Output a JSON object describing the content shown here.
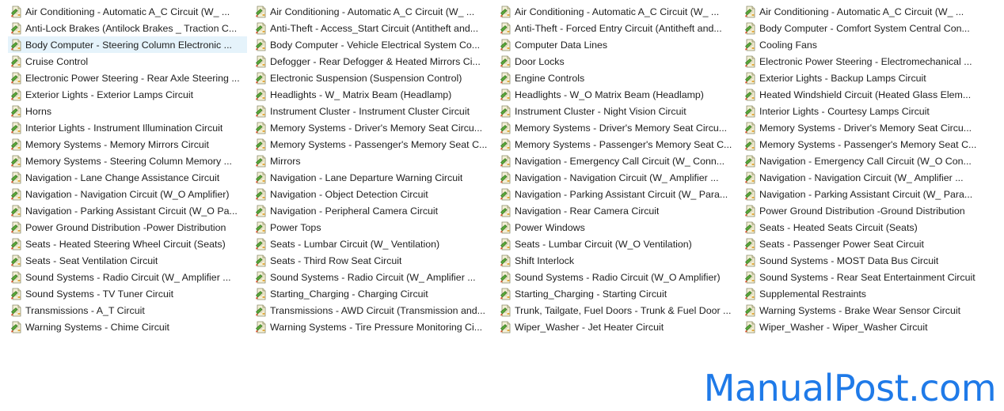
{
  "columns": [
    [
      "Air Conditioning - Automatic A_C Circuit (W_ ...",
      "Anti-Lock Brakes (Antilock Brakes _ Traction C...",
      "Body Computer - Steering Column Electronic ...",
      "Cruise Control",
      "Electronic Power Steering - Rear Axle Steering ...",
      "Exterior Lights - Exterior Lamps Circuit",
      "Horns",
      "Interior Lights - Instrument Illumination Circuit",
      "Memory Systems - Memory Mirrors Circuit",
      "Memory Systems - Steering Column Memory ...",
      "Navigation - Lane Change Assistance Circuit",
      "Navigation - Navigation Circuit (W_O Amplifier)",
      "Navigation - Parking Assistant Circuit (W_O Pa...",
      "Power Ground Distribution -Power Distribution",
      "Seats - Heated Steering Wheel Circuit (Seats)",
      "Seats - Seat Ventilation Circuit",
      "Sound Systems - Radio Circuit (W_ Amplifier ...",
      "Sound Systems - TV Tuner Circuit",
      "Transmissions - A_T Circuit",
      "Warning Systems - Chime Circuit"
    ],
    [
      "Air Conditioning - Automatic A_C Circuit (W_ ...",
      "Anti-Theft - Access_Start Circuit (Antitheft and...",
      "Body Computer - Vehicle Electrical System Co...",
      "Defogger - Rear Defogger & Heated Mirrors Ci...",
      "Electronic Suspension (Suspension Control)",
      "Headlights - W_ Matrix Beam (Headlamp)",
      "Instrument Cluster - Instrument Cluster Circuit",
      "Memory Systems - Driver's Memory Seat Circu...",
      "Memory Systems - Passenger's Memory Seat C...",
      "Mirrors",
      "Navigation - Lane Departure Warning Circuit",
      "Navigation - Object Detection Circuit",
      "Navigation - Peripheral Camera Circuit",
      "Power Tops",
      "Seats - Lumbar Circuit (W_ Ventilation)",
      "Seats - Third Row Seat Circuit",
      "Sound Systems - Radio Circuit (W_ Amplifier ...",
      "Starting_Charging - Charging Circuit",
      "Transmissions - AWD Circuit (Transmission and...",
      "Warning Systems - Tire Pressure Monitoring Ci..."
    ],
    [
      "Air Conditioning - Automatic A_C Circuit (W_ ...",
      "Anti-Theft - Forced Entry Circuit (Antitheft and...",
      "Computer Data Lines",
      "Door Locks",
      "Engine Controls",
      "Headlights - W_O Matrix Beam (Headlamp)",
      "Instrument Cluster - Night Vision Circuit",
      "Memory Systems - Driver's Memory Seat Circu...",
      "Memory Systems - Passenger's Memory Seat C...",
      "Navigation - Emergency Call Circuit (W_ Conn...",
      "Navigation - Navigation Circuit (W_ Amplifier ...",
      "Navigation - Parking Assistant Circuit (W_ Para...",
      "Navigation - Rear Camera Circuit",
      "Power Windows",
      "Seats - Lumbar Circuit (W_O Ventilation)",
      "Shift Interlock",
      "Sound Systems - Radio Circuit (W_O Amplifier)",
      "Starting_Charging - Starting Circuit",
      "Trunk, Tailgate, Fuel Doors - Trunk & Fuel Door ...",
      "Wiper_Washer - Jet Heater Circuit"
    ],
    [
      "Air Conditioning - Automatic A_C Circuit (W_ ...",
      "Body Computer - Comfort System Central Con...",
      "Cooling Fans",
      "Electronic Power Steering - Electromechanical ...",
      "Exterior Lights - Backup Lamps Circuit",
      "Heated Windshield Circuit (Heated Glass Elem...",
      "Interior Lights - Courtesy Lamps Circuit",
      "Memory Systems - Driver's Memory Seat Circu...",
      "Memory Systems - Passenger's Memory Seat C...",
      "Navigation - Emergency Call Circuit (W_O Con...",
      "Navigation - Navigation Circuit (W_ Amplifier ...",
      "Navigation - Parking Assistant Circuit (W_ Para...",
      "Power Ground Distribution -Ground Distribution",
      "Seats - Heated Seats Circuit (Seats)",
      "Seats - Passenger Power Seat Circuit",
      "Sound Systems - MOST Data Bus Circuit",
      "Sound Systems - Rear Seat Entertainment Circuit",
      "Supplemental Restraints",
      "Warning Systems - Brake Wear Sensor Circuit",
      "Wiper_Washer - Wiper_Washer Circuit"
    ]
  ],
  "selected": {
    "column": 0,
    "row": 2
  },
  "icon": "file-icon",
  "watermark": "ManualPost.com",
  "colors": {
    "selection": "#e5f3fb",
    "watermark": "#1f7ae8",
    "text": "#1e1e1e"
  }
}
